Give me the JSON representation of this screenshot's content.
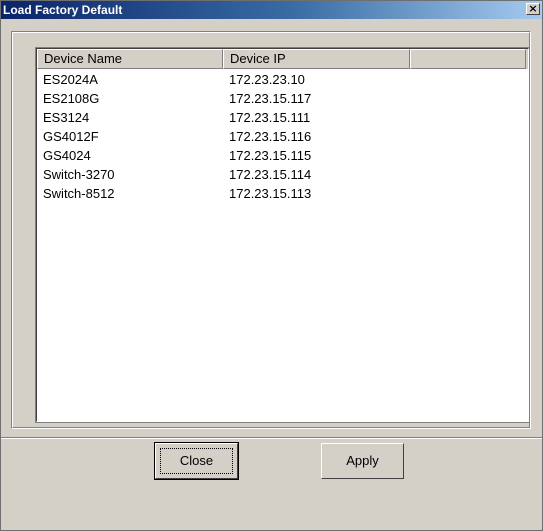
{
  "window": {
    "title": "Load Factory Default",
    "close_glyph": "×"
  },
  "table": {
    "columns": [
      "Device Name",
      "Device IP",
      ""
    ],
    "rows": [
      {
        "name": "ES2024A",
        "ip": "172.23.23.10"
      },
      {
        "name": "ES2108G",
        "ip": "172.23.15.117"
      },
      {
        "name": "ES3124",
        "ip": "172.23.15.111"
      },
      {
        "name": "GS4012F",
        "ip": "172.23.15.116"
      },
      {
        "name": "GS4024",
        "ip": "172.23.15.115"
      },
      {
        "name": "Switch-3270",
        "ip": "172.23.15.114"
      },
      {
        "name": "Switch-8512",
        "ip": "172.23.15.113"
      }
    ]
  },
  "buttons": {
    "close_label": "Close",
    "apply_label": "Apply"
  }
}
